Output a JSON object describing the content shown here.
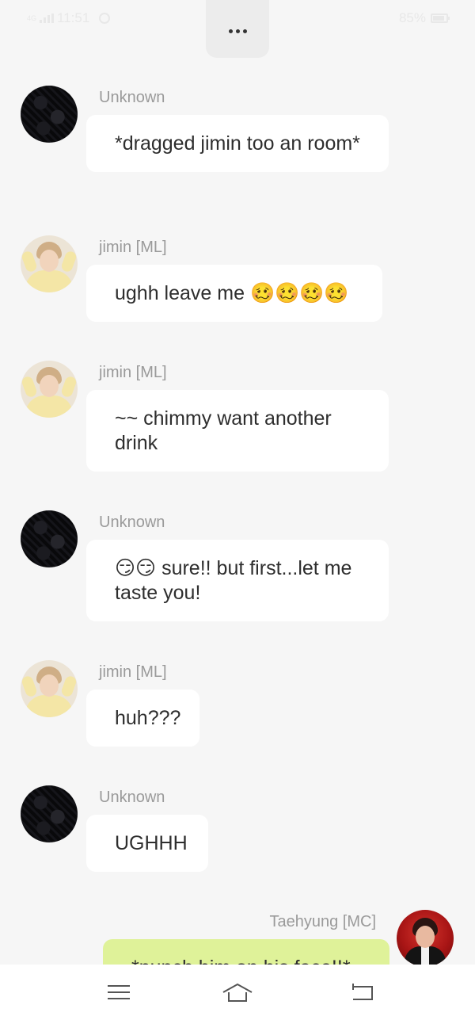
{
  "status_bar": {
    "network": "4G",
    "time": "11:51",
    "battery": "85%"
  },
  "messages": [
    {
      "sender": "Unknown",
      "text": "*dragged jimin too an room*",
      "avatar": "unknown-avatar"
    },
    {
      "sender": "jimin [ML]",
      "text": "ughh leave me 🥴🥴🥴🥴",
      "avatar": "jimin-avatar"
    },
    {
      "sender": "jimin [ML]",
      "text": "~~ chimmy want another drink",
      "avatar": "jimin-avatar"
    },
    {
      "sender": "Unknown",
      "text": "😏😏 sure!! but first...let me taste you!",
      "avatar": "unknown-avatar"
    },
    {
      "sender": "jimin [ML]",
      "text": "huh???",
      "avatar": "jimin-avatar"
    },
    {
      "sender": "Unknown",
      "text": "UGHHH",
      "avatar": "unknown-avatar"
    },
    {
      "sender": "Taehyung [MC]",
      "text": "*punch him on his face!!*",
      "avatar": "taehyung-avatar"
    }
  ],
  "nav": {
    "menu_icon": "menu-icon",
    "home_icon": "home-icon",
    "back_icon": "back-icon"
  },
  "colors": {
    "background": "#f6f6f6",
    "bubble": "#ffffff",
    "my_bubble": "#dff299",
    "sender_text": "#9a9a9a"
  }
}
